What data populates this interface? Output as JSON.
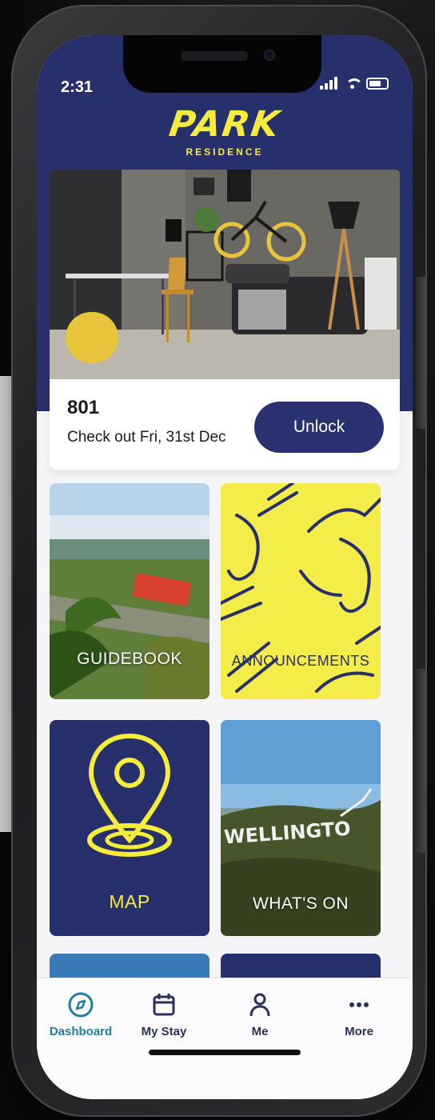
{
  "status_bar": {
    "time": "2:31"
  },
  "brand": {
    "name": "PARK",
    "subtitle": "RESIDENCE"
  },
  "room": {
    "number": "801",
    "checkout": "Check out Fri, 31st Dec",
    "unlock_label": "Unlock"
  },
  "tiles": [
    {
      "label": "GUIDEBOOK"
    },
    {
      "label": "ANNOUNCEMENTS"
    },
    {
      "label": "MAP"
    },
    {
      "label": "WHAT'S ON"
    }
  ],
  "wellington_sign": "WELLINGTO",
  "tabbar": {
    "items": [
      {
        "label": "Dashboard",
        "icon": "compass-icon",
        "active": true
      },
      {
        "label": "My Stay",
        "icon": "calendar-icon"
      },
      {
        "label": "Me",
        "icon": "person-icon"
      },
      {
        "label": "More",
        "icon": "more-dots-icon"
      }
    ]
  },
  "colors": {
    "navy": "#27306A",
    "yellow": "#F5EC3B",
    "active_tab": "#1F7FA3"
  }
}
